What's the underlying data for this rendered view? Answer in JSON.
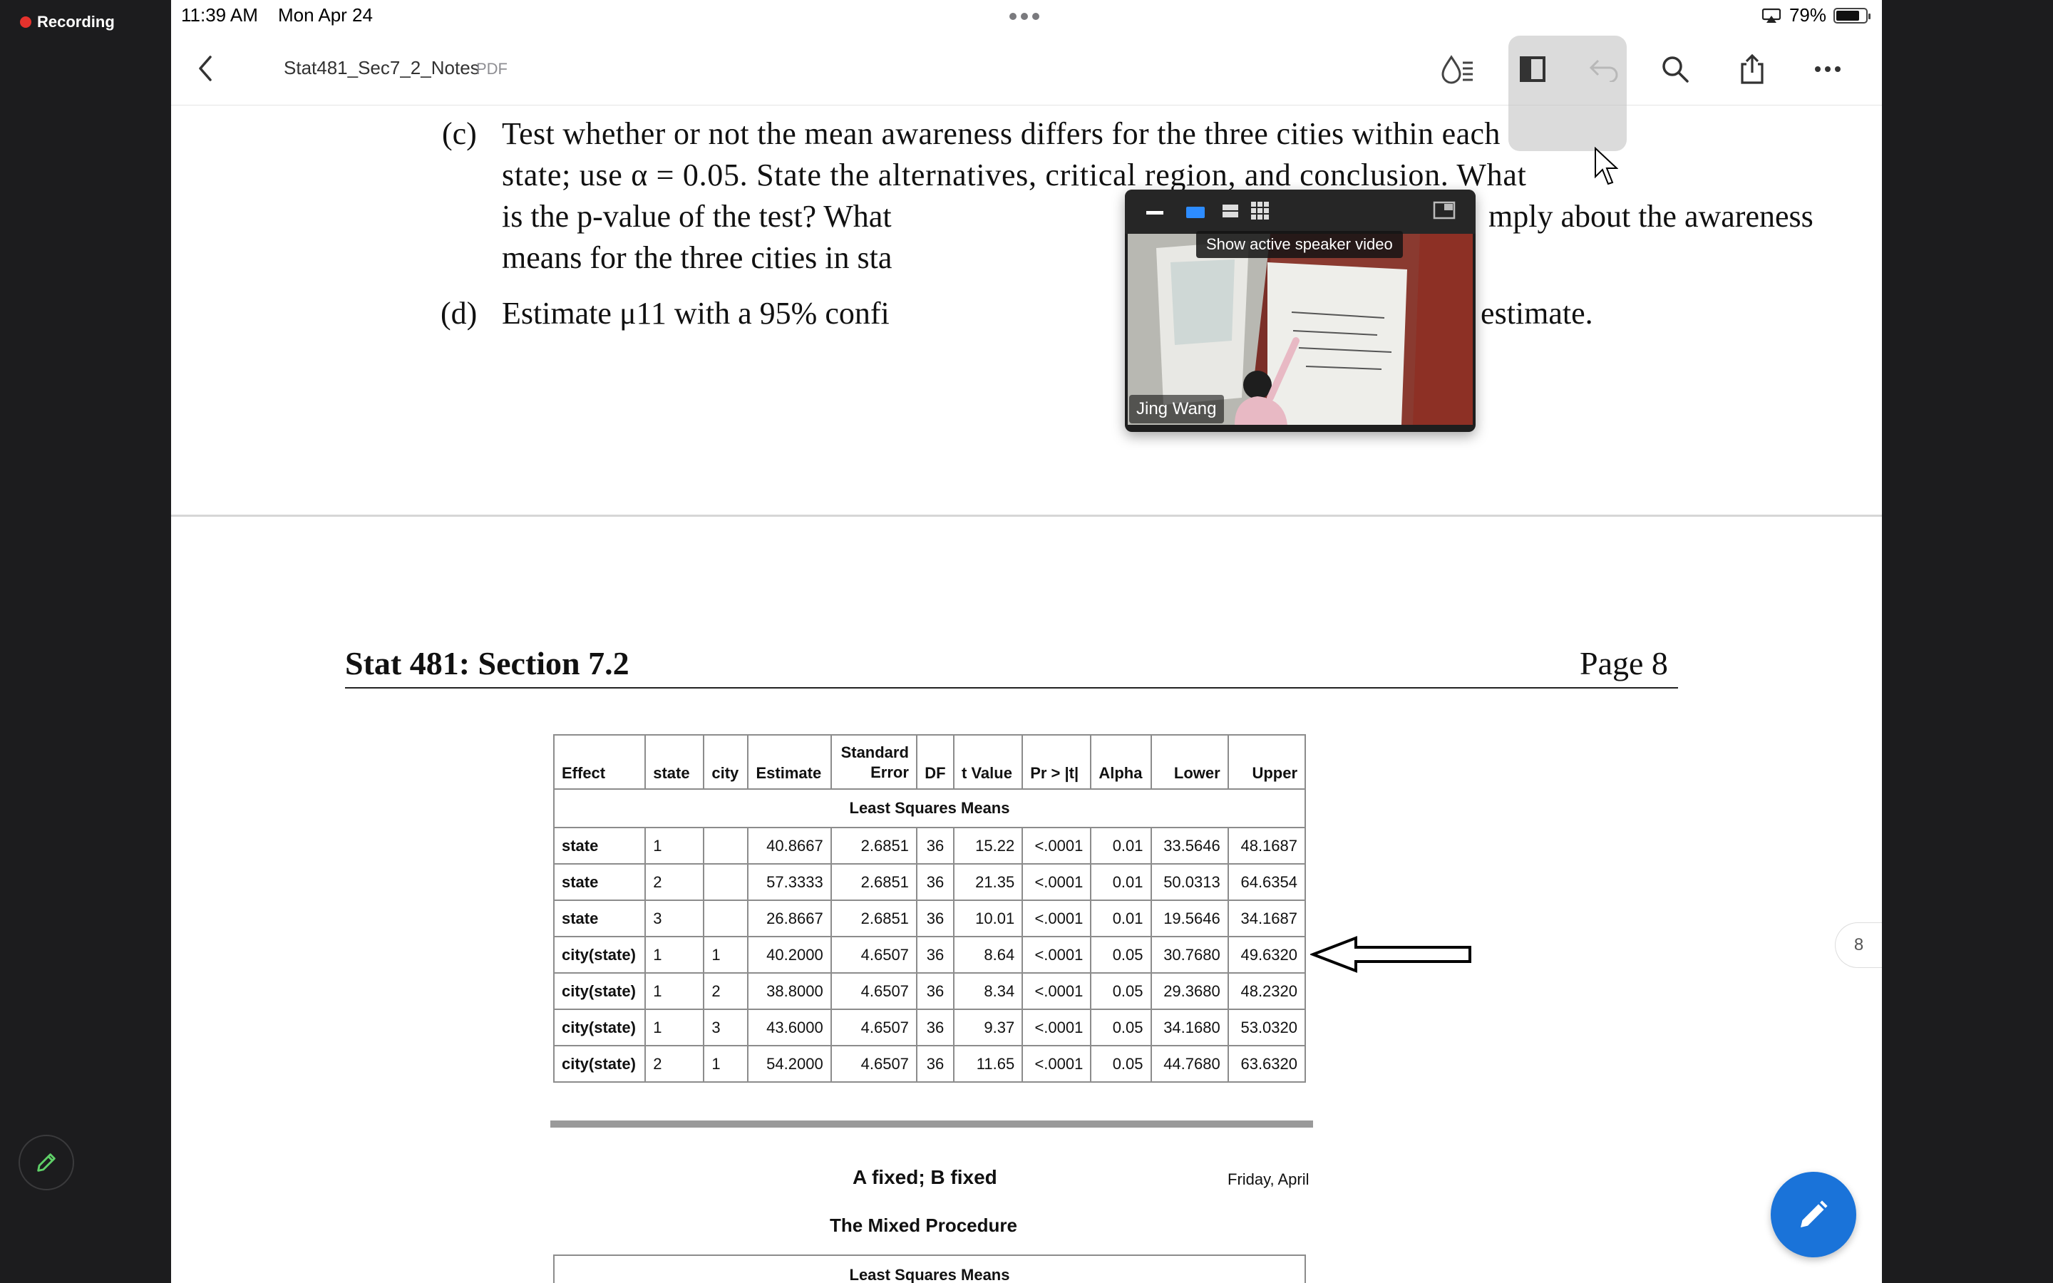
{
  "recording": {
    "label": "Recording"
  },
  "status_bar": {
    "time": "11:39 AM",
    "date": "Mon Apr 24",
    "battery": "79%"
  },
  "nav": {
    "title": "Stat481_Sec7_2_Notes",
    "doc_type": "PDF"
  },
  "question_c": {
    "label": "(c)",
    "lines": [
      "Test whether or not the mean awareness differs for the three cities within each",
      "state; use α = 0.05. State the alternatives, critical region, and conclusion. What",
      "is the p-value of the test? What",
      "mply about the awareness",
      "means for the three cities in sta"
    ]
  },
  "question_d": {
    "label": "(d)",
    "text_left": "Estimate μ11 with a 95% confi",
    "text_right": "your interval estimate."
  },
  "page_header": {
    "left": "Stat 481: Section 7.2",
    "right": "Page 8"
  },
  "table": {
    "title": "Least Squares Means",
    "headers": [
      "Effect",
      "state",
      "city",
      "Estimate",
      "Standard Error",
      "DF",
      "t Value",
      "Pr > |t|",
      "Alpha",
      "Lower",
      "Upper"
    ],
    "rows": [
      [
        "state",
        "1",
        "",
        "40.8667",
        "2.6851",
        "36",
        "15.22",
        "<.0001",
        "0.01",
        "33.5646",
        "48.1687"
      ],
      [
        "state",
        "2",
        "",
        "57.3333",
        "2.6851",
        "36",
        "21.35",
        "<.0001",
        "0.01",
        "50.0313",
        "64.6354"
      ],
      [
        "state",
        "3",
        "",
        "26.8667",
        "2.6851",
        "36",
        "10.01",
        "<.0001",
        "0.01",
        "19.5646",
        "34.1687"
      ],
      [
        "city(state)",
        "1",
        "1",
        "40.2000",
        "4.6507",
        "36",
        "8.64",
        "<.0001",
        "0.05",
        "30.7680",
        "49.6320"
      ],
      [
        "city(state)",
        "1",
        "2",
        "38.8000",
        "4.6507",
        "36",
        "8.34",
        "<.0001",
        "0.05",
        "29.3680",
        "48.2320"
      ],
      [
        "city(state)",
        "1",
        "3",
        "43.6000",
        "4.6507",
        "36",
        "9.37",
        "<.0001",
        "0.05",
        "34.1680",
        "53.0320"
      ],
      [
        "city(state)",
        "2",
        "1",
        "54.2000",
        "4.6507",
        "36",
        "11.65",
        "<.0001",
        "0.05",
        "44.7680",
        "63.6320"
      ]
    ]
  },
  "section2": {
    "heading": "A fixed; B fixed",
    "date": "Friday, April",
    "procedure": "The Mixed Procedure",
    "table_title": "Least Squares Means"
  },
  "page_indicator": "8",
  "video": {
    "tooltip": "Show active speaker video",
    "speaker": "Jing Wang"
  },
  "colors": {
    "accent": "#1a73d9",
    "recording": "#e5322d"
  }
}
